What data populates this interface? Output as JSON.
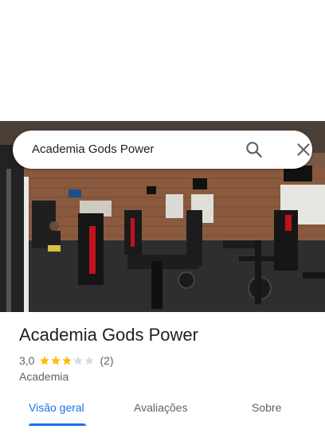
{
  "search": {
    "query": "Academia Gods Power",
    "search_icon": "search-icon",
    "close_icon": "close-icon"
  },
  "place": {
    "name": "Academia Gods Power",
    "rating": "3,0",
    "stars": 3,
    "max_stars": 5,
    "review_count": "(2)",
    "category": "Academia"
  },
  "tabs": [
    {
      "label": "Visão geral",
      "active": true
    },
    {
      "label": "Avaliações",
      "active": false
    },
    {
      "label": "Sobre",
      "active": false
    }
  ],
  "colors": {
    "accent": "#1a73e8",
    "star": "#fbbc04",
    "star_empty": "#dadce0"
  }
}
